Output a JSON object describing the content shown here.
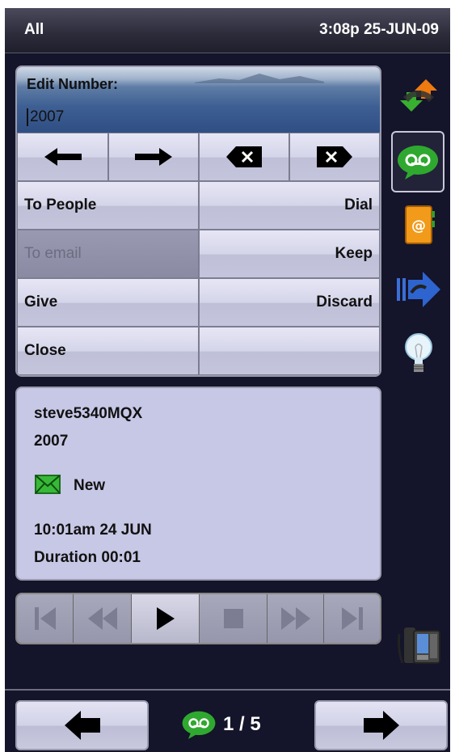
{
  "status": {
    "filter": "All",
    "datetime": "3:08p 25-JUN-09"
  },
  "edit": {
    "label": "Edit Number:",
    "value": "2007"
  },
  "edit_keys": [
    {
      "icon": "arrow-left-icon"
    },
    {
      "icon": "arrow-right-icon"
    },
    {
      "icon": "backspace-icon"
    },
    {
      "icon": "delete-icon"
    }
  ],
  "actions": {
    "to_people": "To People",
    "dial": "Dial",
    "to_email": "To email",
    "keep": "Keep",
    "give": "Give",
    "discard": "Discard",
    "close": "Close"
  },
  "message": {
    "sender": "steve5340MQX",
    "number": "2007",
    "state": "New",
    "time": "10:01am  24 JUN",
    "duration": "Duration 00:01"
  },
  "player": [
    "skip-start-icon",
    "rewind-icon",
    "play-icon",
    "stop-icon",
    "fast-forward-icon",
    "skip-end-icon"
  ],
  "sidebar": [
    "call-log-icon",
    "voicemail-icon",
    "contacts-icon",
    "forward-icon",
    "tips-lightbulb-icon",
    "desk-phone-icon"
  ],
  "pager": {
    "text": "1 / 5"
  },
  "colors": {
    "screen_bg": "#14142a",
    "button_face": "#d5d5ea",
    "info_bg": "#c7c7e6",
    "voicemail_green": "#2fa82f"
  }
}
